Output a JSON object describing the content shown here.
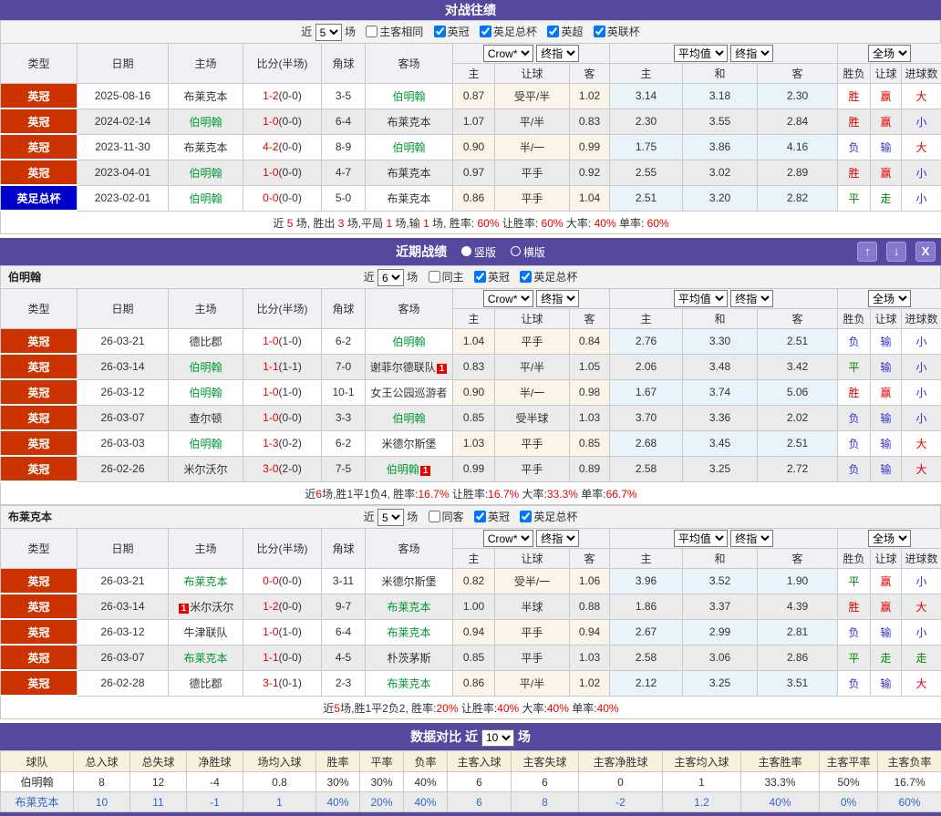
{
  "colors": {
    "accent_purple": "#55489e",
    "button_purple": "#8678cc",
    "badge_red": "#cc3300",
    "badge_blue": "#0000cc",
    "team_green": "#009933",
    "win_red": "#e60000",
    "lose_blue": "#3333cc",
    "draw_green": "#008800"
  },
  "tables_common": {
    "main_headers": [
      "类型",
      "日期",
      "主场",
      "比分(半场)",
      "角球",
      "客场"
    ],
    "sub_headers": [
      "主",
      "让球",
      "客",
      "主",
      "和",
      "客",
      "胜负",
      "让球",
      "进球数"
    ],
    "selects": {
      "crow": "Crow*",
      "final": "终指",
      "avg": "平均值",
      "final2": "终指",
      "scope": "全场"
    }
  },
  "h2h": {
    "title": "对战往绩",
    "near_label": "近",
    "games_label": "场",
    "near_value": "5",
    "filters": [
      {
        "label": "主客相同",
        "checked": false
      },
      {
        "label": "英冠",
        "checked": true
      },
      {
        "label": "英足总杯",
        "checked": true
      },
      {
        "label": "英超",
        "checked": true
      },
      {
        "label": "英联杯",
        "checked": true
      }
    ],
    "rows": [
      {
        "league": "英冠",
        "league_color": "#cc3300",
        "date": "2025-08-16",
        "home": {
          "name": "布莱克本",
          "focus": false
        },
        "score": "1-2",
        "half": "(0-0)",
        "corner": "3-5",
        "away": {
          "name": "伯明翰",
          "focus": true
        },
        "odds": [
          "0.87",
          "受平/半",
          "1.02"
        ],
        "avg": [
          "3.14",
          "3.18",
          "2.30"
        ],
        "results": [
          [
            "胜",
            "red"
          ],
          [
            "赢",
            "red"
          ],
          [
            "大",
            "red"
          ]
        ]
      },
      {
        "league": "英冠",
        "league_color": "#cc3300",
        "date": "2024-02-14",
        "home": {
          "name": "伯明翰",
          "focus": true
        },
        "score": "1-0",
        "half": "(0-0)",
        "corner": "6-4",
        "away": {
          "name": "布莱克本",
          "focus": false
        },
        "odds": [
          "1.07",
          "平/半",
          "0.83"
        ],
        "avg": [
          "2.30",
          "3.55",
          "2.84"
        ],
        "results": [
          [
            "胜",
            "red"
          ],
          [
            "赢",
            "red"
          ],
          [
            "小",
            "blue"
          ]
        ]
      },
      {
        "league": "英冠",
        "league_color": "#cc3300",
        "date": "2023-11-30",
        "home": {
          "name": "布莱克本",
          "focus": false
        },
        "score": "4-2",
        "half": "(0-0)",
        "corner": "8-9",
        "away": {
          "name": "伯明翰",
          "focus": true
        },
        "odds": [
          "0.90",
          "半/一",
          "0.99"
        ],
        "avg": [
          "1.75",
          "3.86",
          "4.16"
        ],
        "results": [
          [
            "负",
            "blue"
          ],
          [
            "输",
            "blue"
          ],
          [
            "大",
            "red"
          ]
        ]
      },
      {
        "league": "英冠",
        "league_color": "#cc3300",
        "date": "2023-04-01",
        "home": {
          "name": "伯明翰",
          "focus": true
        },
        "score": "1-0",
        "half": "(0-0)",
        "corner": "4-7",
        "away": {
          "name": "布莱克本",
          "focus": false
        },
        "odds": [
          "0.97",
          "平手",
          "0.92"
        ],
        "avg": [
          "2.55",
          "3.02",
          "2.89"
        ],
        "results": [
          [
            "胜",
            "red"
          ],
          [
            "赢",
            "red"
          ],
          [
            "小",
            "blue"
          ]
        ]
      },
      {
        "league": "英足总杯",
        "league_color": "#0000cc",
        "date": "2023-02-01",
        "home": {
          "name": "伯明翰",
          "focus": true
        },
        "score": "0-0",
        "half": "(0-0)",
        "corner": "5-0",
        "away": {
          "name": "布莱克本",
          "focus": false
        },
        "odds": [
          "0.86",
          "平手",
          "1.04"
        ],
        "avg": [
          "2.51",
          "3.20",
          "2.82"
        ],
        "results": [
          [
            "平",
            "green"
          ],
          [
            "走",
            "green"
          ],
          [
            "小",
            "blue"
          ]
        ]
      }
    ],
    "summary": [
      {
        "t": "近 "
      },
      {
        "t": "5",
        "red": true
      },
      {
        "t": " 场, 胜出 "
      },
      {
        "t": "3",
        "red": true
      },
      {
        "t": " 场,平局 "
      },
      {
        "t": "1",
        "red": true
      },
      {
        "t": " 场,输 "
      },
      {
        "t": "1",
        "red": true
      },
      {
        "t": " 场, 胜率: "
      },
      {
        "t": "60%",
        "red": true
      },
      {
        "t": " 让胜率: "
      },
      {
        "t": "60%",
        "red": true
      },
      {
        "t": " 大率: "
      },
      {
        "t": "40%",
        "red": true
      },
      {
        "t": " 单率: "
      },
      {
        "t": "60%",
        "red": true
      }
    ]
  },
  "recent": {
    "title": "近期战绩",
    "view_modes": [
      {
        "label": "竖版",
        "selected": true
      },
      {
        "label": "横版",
        "selected": false
      }
    ],
    "buttons": {
      "up": "↑",
      "down": "↓",
      "close": "X"
    },
    "near_label": "近",
    "games_label": "场",
    "teams": [
      {
        "name": "伯明翰",
        "near_value": "6",
        "filters": [
          {
            "label": "同主",
            "checked": false
          },
          {
            "label": "英冠",
            "checked": true
          },
          {
            "label": "英足总杯",
            "checked": true
          }
        ],
        "rows": [
          {
            "league": "英冠",
            "league_color": "#cc3300",
            "date": "26-03-21",
            "home": {
              "name": "德比郡",
              "focus": false
            },
            "score": "1-0",
            "half": "(1-0)",
            "corner": "6-2",
            "away": {
              "name": "伯明翰",
              "focus": true
            },
            "odds": [
              "1.04",
              "平手",
              "0.84"
            ],
            "avg": [
              "2.76",
              "3.30",
              "2.51"
            ],
            "results": [
              [
                "负",
                "blue"
              ],
              [
                "输",
                "blue"
              ],
              [
                "小",
                "blue"
              ]
            ]
          },
          {
            "league": "英冠",
            "league_color": "#cc3300",
            "date": "26-03-14",
            "home": {
              "name": "伯明翰",
              "focus": true
            },
            "score": "1-1",
            "half": "(1-1)",
            "corner": "7-0",
            "away": {
              "name": "谢菲尔德联队",
              "focus": false,
              "card": "1",
              "card_pos": "after"
            },
            "odds": [
              "0.83",
              "平/半",
              "1.05"
            ],
            "avg": [
              "2.06",
              "3.48",
              "3.42"
            ],
            "results": [
              [
                "平",
                "green"
              ],
              [
                "输",
                "blue"
              ],
              [
                "小",
                "blue"
              ]
            ]
          },
          {
            "league": "英冠",
            "league_color": "#cc3300",
            "date": "26-03-12",
            "home": {
              "name": "伯明翰",
              "focus": true
            },
            "score": "1-0",
            "half": "(1-0)",
            "corner": "10-1",
            "away": {
              "name": "女王公园巡游者",
              "focus": false
            },
            "odds": [
              "0.90",
              "半/一",
              "0.98"
            ],
            "avg": [
              "1.67",
              "3.74",
              "5.06"
            ],
            "results": [
              [
                "胜",
                "red"
              ],
              [
                "赢",
                "red"
              ],
              [
                "小",
                "blue"
              ]
            ]
          },
          {
            "league": "英冠",
            "league_color": "#cc3300",
            "date": "26-03-07",
            "home": {
              "name": "查尔顿",
              "focus": false
            },
            "score": "1-0",
            "half": "(0-0)",
            "corner": "3-3",
            "away": {
              "name": "伯明翰",
              "focus": true
            },
            "odds": [
              "0.85",
              "受半球",
              "1.03"
            ],
            "avg": [
              "3.70",
              "3.36",
              "2.02"
            ],
            "results": [
              [
                "负",
                "blue"
              ],
              [
                "输",
                "blue"
              ],
              [
                "小",
                "blue"
              ]
            ]
          },
          {
            "league": "英冠",
            "league_color": "#cc3300",
            "date": "26-03-03",
            "home": {
              "name": "伯明翰",
              "focus": true
            },
            "score": "1-3",
            "half": "(0-2)",
            "corner": "6-2",
            "away": {
              "name": "米德尔斯堡",
              "focus": false
            },
            "odds": [
              "1.03",
              "平手",
              "0.85"
            ],
            "avg": [
              "2.68",
              "3.45",
              "2.51"
            ],
            "results": [
              [
                "负",
                "blue"
              ],
              [
                "输",
                "blue"
              ],
              [
                "大",
                "red"
              ]
            ]
          },
          {
            "league": "英冠",
            "league_color": "#cc3300",
            "date": "26-02-26",
            "home": {
              "name": "米尔沃尔",
              "focus": false
            },
            "score": "3-0",
            "half": "(2-0)",
            "corner": "7-5",
            "away": {
              "name": "伯明翰",
              "focus": true,
              "card": "1",
              "card_pos": "after"
            },
            "odds": [
              "0.99",
              "平手",
              "0.89"
            ],
            "avg": [
              "2.58",
              "3.25",
              "2.72"
            ],
            "results": [
              [
                "负",
                "blue"
              ],
              [
                "输",
                "blue"
              ],
              [
                "大",
                "red"
              ]
            ]
          }
        ],
        "summary": [
          {
            "t": "近"
          },
          {
            "t": "6",
            "red": true
          },
          {
            "t": "场,胜1平1负4, 胜率:"
          },
          {
            "t": "16.7%",
            "red": true
          },
          {
            "t": " 让胜率:"
          },
          {
            "t": "16.7%",
            "red": true
          },
          {
            "t": " 大率:"
          },
          {
            "t": "33.3%",
            "red": true
          },
          {
            "t": " 单率:"
          },
          {
            "t": "66.7%",
            "red": true
          }
        ]
      },
      {
        "name": "布莱克本",
        "near_value": "5",
        "filters": [
          {
            "label": "同客",
            "checked": false
          },
          {
            "label": "英冠",
            "checked": true
          },
          {
            "label": "英足总杯",
            "checked": true
          }
        ],
        "rows": [
          {
            "league": "英冠",
            "league_color": "#cc3300",
            "date": "26-03-21",
            "home": {
              "name": "布莱克本",
              "focus": true
            },
            "score": "0-0",
            "half": "(0-0)",
            "corner": "3-11",
            "away": {
              "name": "米德尔斯堡",
              "focus": false
            },
            "odds": [
              "0.82",
              "受半/一",
              "1.06"
            ],
            "avg": [
              "3.96",
              "3.52",
              "1.90"
            ],
            "results": [
              [
                "平",
                "green"
              ],
              [
                "赢",
                "red"
              ],
              [
                "小",
                "blue"
              ]
            ]
          },
          {
            "league": "英冠",
            "league_color": "#cc3300",
            "date": "26-03-14",
            "home": {
              "name": "米尔沃尔",
              "focus": false,
              "card": "1",
              "card_pos": "before"
            },
            "score": "1-2",
            "half": "(0-0)",
            "corner": "9-7",
            "away": {
              "name": "布莱克本",
              "focus": true
            },
            "odds": [
              "1.00",
              "半球",
              "0.88"
            ],
            "avg": [
              "1.86",
              "3.37",
              "4.39"
            ],
            "results": [
              [
                "胜",
                "red"
              ],
              [
                "赢",
                "red"
              ],
              [
                "大",
                "red"
              ]
            ]
          },
          {
            "league": "英冠",
            "league_color": "#cc3300",
            "date": "26-03-12",
            "home": {
              "name": "牛津联队",
              "focus": false
            },
            "score": "1-0",
            "half": "(1-0)",
            "corner": "6-4",
            "away": {
              "name": "布莱克本",
              "focus": true
            },
            "odds": [
              "0.94",
              "平手",
              "0.94"
            ],
            "avg": [
              "2.67",
              "2.99",
              "2.81"
            ],
            "results": [
              [
                "负",
                "blue"
              ],
              [
                "输",
                "blue"
              ],
              [
                "小",
                "blue"
              ]
            ]
          },
          {
            "league": "英冠",
            "league_color": "#cc3300",
            "date": "26-03-07",
            "home": {
              "name": "布莱克本",
              "focus": true
            },
            "score": "1-1",
            "half": "(0-0)",
            "corner": "4-5",
            "away": {
              "name": "朴茨茅斯",
              "focus": false
            },
            "odds": [
              "0.85",
              "平手",
              "1.03"
            ],
            "avg": [
              "2.58",
              "3.06",
              "2.86"
            ],
            "results": [
              [
                "平",
                "green"
              ],
              [
                "走",
                "green"
              ],
              [
                "走",
                "green"
              ]
            ]
          },
          {
            "league": "英冠",
            "league_color": "#cc3300",
            "date": "26-02-28",
            "home": {
              "name": "德比郡",
              "focus": false
            },
            "score": "3-1",
            "half": "(0-1)",
            "corner": "2-3",
            "away": {
              "name": "布莱克本",
              "focus": true
            },
            "odds": [
              "0.86",
              "平/半",
              "1.02"
            ],
            "avg": [
              "2.12",
              "3.25",
              "3.51"
            ],
            "results": [
              [
                "负",
                "blue"
              ],
              [
                "输",
                "blue"
              ],
              [
                "大",
                "red"
              ]
            ]
          }
        ],
        "summary": [
          {
            "t": "近"
          },
          {
            "t": "5",
            "red": true
          },
          {
            "t": "场,胜1平2负2, 胜率:"
          },
          {
            "t": "20%",
            "red": true
          },
          {
            "t": " 让胜率:"
          },
          {
            "t": "40%",
            "red": true
          },
          {
            "t": " 大率:"
          },
          {
            "t": "40%",
            "red": true
          },
          {
            "t": " 单率:"
          },
          {
            "t": "40%",
            "red": true
          }
        ]
      }
    ]
  },
  "compare": {
    "title": "数据对比",
    "near_label": "近",
    "near_value": "10",
    "games_label": "场",
    "headers": [
      "球队",
      "总入球",
      "总失球",
      "净胜球",
      "场均入球",
      "胜率",
      "平率",
      "负率",
      "主客入球",
      "主客失球",
      "主客净胜球",
      "主客均入球",
      "主客胜率",
      "主客平率",
      "主客负率"
    ],
    "rows": [
      {
        "team": "伯明翰",
        "highlight": false,
        "values": [
          "8",
          "12",
          "-4",
          "0.8",
          "30%",
          "30%",
          "40%",
          "6",
          "6",
          "0",
          "1",
          "33.3%",
          "50%",
          "16.7%"
        ]
      },
      {
        "team": "布莱克本",
        "highlight": true,
        "values": [
          "10",
          "11",
          "-1",
          "1",
          "40%",
          "20%",
          "40%",
          "6",
          "8",
          "-2",
          "1.2",
          "40%",
          "0%",
          "60%"
        ]
      }
    ]
  }
}
